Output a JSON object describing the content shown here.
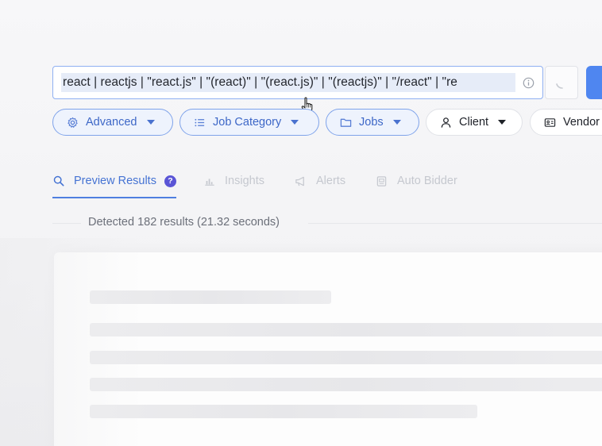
{
  "search": {
    "query": "react | reactjs | \"react.js\" | \"(react)\" | \"(react.js)\" | \"(reactjs)\" | \"/react\" | \"re"
  },
  "filters": [
    {
      "label": "Advanced",
      "icon": "gear-icon"
    },
    {
      "label": "Job Category",
      "icon": "list-icon"
    },
    {
      "label": "Jobs",
      "icon": "folder-icon"
    },
    {
      "label": "Client",
      "icon": "user-icon"
    },
    {
      "label": "Vendor",
      "icon": "id-card-icon"
    }
  ],
  "tabs": [
    {
      "label": "Preview Results",
      "icon": "search-icon",
      "badge": "?"
    },
    {
      "label": "Insights",
      "icon": "bar-chart-icon"
    },
    {
      "label": "Alerts",
      "icon": "megaphone-icon"
    },
    {
      "label": "Auto Bidder",
      "icon": "robot-icon"
    }
  ],
  "results": {
    "detected_text": "Detected 182 results (21.32 seconds)"
  },
  "colors": {
    "accent": "#4f7fe0",
    "chip_border": "#7fa3ea",
    "badge": "#5a55d6",
    "submit_button": "#4f86f0"
  }
}
